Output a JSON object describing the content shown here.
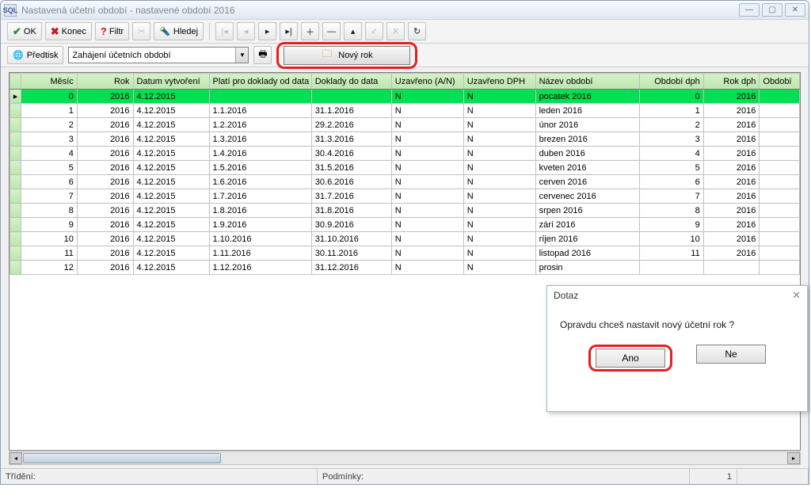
{
  "window": {
    "title": "Nastavená účetní období - nastavené období 2016",
    "app_icon_text": "SQL"
  },
  "toolbar": {
    "ok": "OK",
    "konec": "Konec",
    "filtr": "Filtr",
    "hledej": "Hledej",
    "predtisk": "Předtisk",
    "dropdown_value": "Zahájení účetních období",
    "novy_rok": "Nový rok"
  },
  "columns": [
    "Měsíc",
    "Rok",
    "Datum vytvoření",
    "Platí pro doklady od data",
    "Doklady do data",
    "Uzavřeno (A/N)",
    "Uzavřeno DPH",
    "Název období",
    "Období dph",
    "Rok dph",
    "Období"
  ],
  "rows": [
    {
      "mesic": "0",
      "rok": "2016",
      "datvyt": "4.12.2015",
      "plati": "",
      "doklad": "",
      "uzav": "N",
      "uzavdph": "N",
      "nazev": "pocatek 2016",
      "obddph": "0",
      "rokdph": "2016",
      "selected": true
    },
    {
      "mesic": "1",
      "rok": "2016",
      "datvyt": "4.12.2015",
      "plati": "1.1.2016",
      "doklad": "31.1.2016",
      "uzav": "N",
      "uzavdph": "N",
      "nazev": "leden 2016",
      "obddph": "1",
      "rokdph": "2016"
    },
    {
      "mesic": "2",
      "rok": "2016",
      "datvyt": "4.12.2015",
      "plati": "1.2.2016",
      "doklad": "29.2.2016",
      "uzav": "N",
      "uzavdph": "N",
      "nazev": "únor 2016",
      "obddph": "2",
      "rokdph": "2016"
    },
    {
      "mesic": "3",
      "rok": "2016",
      "datvyt": "4.12.2015",
      "plati": "1.3.2016",
      "doklad": "31.3.2016",
      "uzav": "N",
      "uzavdph": "N",
      "nazev": "brezen 2016",
      "obddph": "3",
      "rokdph": "2016"
    },
    {
      "mesic": "4",
      "rok": "2016",
      "datvyt": "4.12.2015",
      "plati": "1.4.2016",
      "doklad": "30.4.2016",
      "uzav": "N",
      "uzavdph": "N",
      "nazev": "duben 2016",
      "obddph": "4",
      "rokdph": "2016"
    },
    {
      "mesic": "5",
      "rok": "2016",
      "datvyt": "4.12.2015",
      "plati": "1.5.2016",
      "doklad": "31.5.2016",
      "uzav": "N",
      "uzavdph": "N",
      "nazev": "kveten 2016",
      "obddph": "5",
      "rokdph": "2016"
    },
    {
      "mesic": "6",
      "rok": "2016",
      "datvyt": "4.12.2015",
      "plati": "1.6.2016",
      "doklad": "30.6.2016",
      "uzav": "N",
      "uzavdph": "N",
      "nazev": "cerven 2016",
      "obddph": "6",
      "rokdph": "2016"
    },
    {
      "mesic": "7",
      "rok": "2016",
      "datvyt": "4.12.2015",
      "plati": "1.7.2016",
      "doklad": "31.7.2016",
      "uzav": "N",
      "uzavdph": "N",
      "nazev": "cervenec 2016",
      "obddph": "7",
      "rokdph": "2016"
    },
    {
      "mesic": "8",
      "rok": "2016",
      "datvyt": "4.12.2015",
      "plati": "1.8.2016",
      "doklad": "31.8.2016",
      "uzav": "N",
      "uzavdph": "N",
      "nazev": "srpen 2016",
      "obddph": "8",
      "rokdph": "2016"
    },
    {
      "mesic": "9",
      "rok": "2016",
      "datvyt": "4.12.2015",
      "plati": "1.9.2016",
      "doklad": "30.9.2016",
      "uzav": "N",
      "uzavdph": "N",
      "nazev": "zárí 2016",
      "obddph": "9",
      "rokdph": "2016"
    },
    {
      "mesic": "10",
      "rok": "2016",
      "datvyt": "4.12.2015",
      "plati": "1.10.2016",
      "doklad": "31.10.2016",
      "uzav": "N",
      "uzavdph": "N",
      "nazev": "ríjen 2016",
      "obddph": "10",
      "rokdph": "2016"
    },
    {
      "mesic": "11",
      "rok": "2016",
      "datvyt": "4.12.2015",
      "plati": "1.11.2016",
      "doklad": "30.11.2016",
      "uzav": "N",
      "uzavdph": "N",
      "nazev": "listopad 2016",
      "obddph": "11",
      "rokdph": "2016"
    },
    {
      "mesic": "12",
      "rok": "2016",
      "datvyt": "4.12.2015",
      "plati": "1.12.2016",
      "doklad": "31.12.2016",
      "uzav": "N",
      "uzavdph": "N",
      "nazev": "prosin",
      "obddph": "",
      "rokdph": ""
    }
  ],
  "statusbar": {
    "trideni_label": "Třídění:",
    "podminky_label": "Podmínky:",
    "record": "1"
  },
  "dialog": {
    "title": "Dotaz",
    "message": "Opravdu chceš nastavit nový účetní rok ?",
    "yes": "Ano",
    "no": "Ne"
  }
}
